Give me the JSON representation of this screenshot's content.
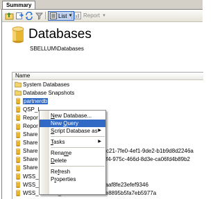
{
  "tab": {
    "label": "Summary"
  },
  "toolbar": {
    "list_label": "List",
    "report_label": "Report"
  },
  "header": {
    "title": "Databases",
    "path": "SBELLUM\\Databases"
  },
  "list": {
    "column": "Name",
    "rows": [
      {
        "label": "System Databases",
        "type": "folder"
      },
      {
        "label": "Database Snapshots",
        "type": "folder"
      },
      {
        "label": "partnerdb",
        "type": "db",
        "selected": true
      },
      {
        "label": "QSP_I",
        "type": "db"
      },
      {
        "label": "Repor",
        "type": "db"
      },
      {
        "label": "Repor",
        "type": "db"
      },
      {
        "label": "Share",
        "type": "db"
      },
      {
        "label": "Share",
        "type": "db"
      },
      {
        "label": "Share",
        "type": "db"
      },
      {
        "label": "Share",
        "type": "db"
      },
      {
        "label": "Share",
        "type": "db"
      },
      {
        "label": "WSS_",
        "type": "db"
      },
      {
        "label": "WSS_Content_11c40db578184feaaf8fe23efef9346",
        "type": "db"
      },
      {
        "label": "WSS_Content_2c7f7a81c0a5495e8895b5fa7eb5977a",
        "type": "db"
      }
    ],
    "overflow_text": [
      {
        "row": 8,
        "text": "c21-7fe0-4ef1-9de2-b1b9d8d2246a"
      },
      {
        "row": 9,
        "text": "f4-975c-466d-8d3e-ca06fd4b89b2"
      }
    ]
  },
  "menu": {
    "items": [
      {
        "label": "New Database...",
        "underline": 0
      },
      {
        "label": "New Query",
        "underline": 4,
        "highlighted": true
      },
      {
        "label": "Script Database as",
        "underline": 0,
        "submenu": true
      },
      {
        "separator": true
      },
      {
        "label": "Tasks",
        "underline": 0,
        "submenu": true
      },
      {
        "separator": true
      },
      {
        "label": "Rename",
        "underline": 4
      },
      {
        "label": "Delete",
        "underline": 0
      },
      {
        "separator": true
      },
      {
        "label": "Refresh",
        "underline": 2
      },
      {
        "label": "Properties",
        "underline": 1
      }
    ]
  },
  "colors": {
    "selection": "#316ac5",
    "folder": "#f3d36b",
    "db": "#e8b630"
  }
}
